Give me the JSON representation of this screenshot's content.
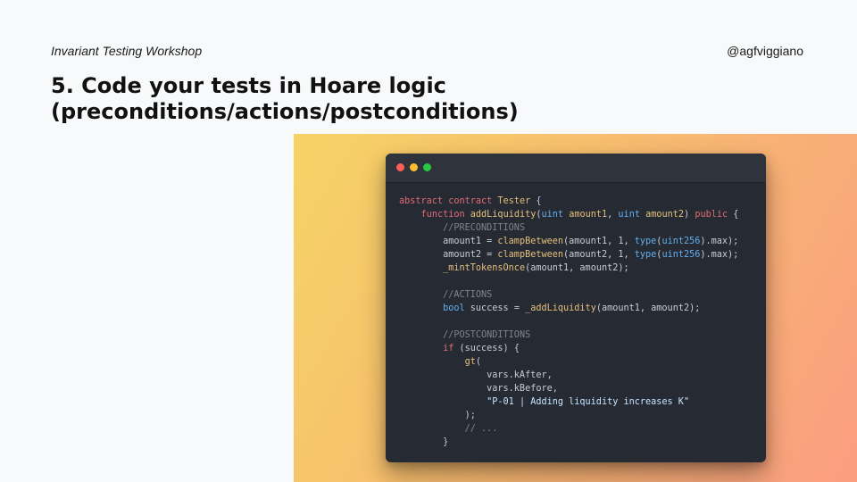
{
  "header": {
    "workshop": "Invariant Testing Workshop",
    "handle": "@agfviggiano",
    "title_line1": "5. Code your tests in Hoare logic",
    "title_line2": "(preconditions/actions/postconditions)"
  },
  "colors": {
    "gradient_start": "#f6d365",
    "gradient_end": "#fa9d80",
    "editor_bg": "#262a33",
    "window_dot_red": "#ff5f57",
    "window_dot_yellow": "#febc2e",
    "window_dot_green": "#28c840"
  },
  "code_lines": [
    [
      {
        "c": "kw",
        "t": "abstract contract"
      },
      {
        "c": "",
        "t": " "
      },
      {
        "c": "fn",
        "t": "Tester"
      },
      {
        "c": "",
        "t": " {"
      }
    ],
    [
      {
        "c": "",
        "t": "    "
      },
      {
        "c": "kw",
        "t": "function"
      },
      {
        "c": "",
        "t": " "
      },
      {
        "c": "fn",
        "t": "addLiquidity"
      },
      {
        "c": "",
        "t": "("
      },
      {
        "c": "ty",
        "t": "uint"
      },
      {
        "c": "",
        "t": " "
      },
      {
        "c": "fn",
        "t": "amount1"
      },
      {
        "c": "",
        "t": ", "
      },
      {
        "c": "ty",
        "t": "uint"
      },
      {
        "c": "",
        "t": " "
      },
      {
        "c": "fn",
        "t": "amount2"
      },
      {
        "c": "",
        "t": ") "
      },
      {
        "c": "kw",
        "t": "public"
      },
      {
        "c": "",
        "t": " {"
      }
    ],
    [
      {
        "c": "",
        "t": "        "
      },
      {
        "c": "cm",
        "t": "//PRECONDITIONS"
      }
    ],
    [
      {
        "c": "",
        "t": "        amount1 = "
      },
      {
        "c": "fn",
        "t": "clampBetween"
      },
      {
        "c": "",
        "t": "(amount1, 1, "
      },
      {
        "c": "ty",
        "t": "type"
      },
      {
        "c": "",
        "t": "("
      },
      {
        "c": "ty",
        "t": "uint256"
      },
      {
        "c": "",
        "t": ").max);"
      }
    ],
    [
      {
        "c": "",
        "t": "        amount2 = "
      },
      {
        "c": "fn",
        "t": "clampBetween"
      },
      {
        "c": "",
        "t": "(amount2, 1, "
      },
      {
        "c": "ty",
        "t": "type"
      },
      {
        "c": "",
        "t": "("
      },
      {
        "c": "ty",
        "t": "uint256"
      },
      {
        "c": "",
        "t": ").max);"
      }
    ],
    [
      {
        "c": "",
        "t": "        "
      },
      {
        "c": "fn",
        "t": "_mintTokensOnce"
      },
      {
        "c": "",
        "t": "(amount1, amount2);"
      }
    ],
    [
      {
        "c": "",
        "t": ""
      }
    ],
    [
      {
        "c": "",
        "t": "        "
      },
      {
        "c": "cm",
        "t": "//ACTIONS"
      }
    ],
    [
      {
        "c": "",
        "t": "        "
      },
      {
        "c": "ty",
        "t": "bool"
      },
      {
        "c": "",
        "t": " success = "
      },
      {
        "c": "fn",
        "t": "_addLiquidity"
      },
      {
        "c": "",
        "t": "(amount1, amount2);"
      }
    ],
    [
      {
        "c": "",
        "t": ""
      }
    ],
    [
      {
        "c": "",
        "t": "        "
      },
      {
        "c": "cm",
        "t": "//POSTCONDITIONS"
      }
    ],
    [
      {
        "c": "",
        "t": "        "
      },
      {
        "c": "kw",
        "t": "if"
      },
      {
        "c": "",
        "t": " (success) {"
      }
    ],
    [
      {
        "c": "",
        "t": "            "
      },
      {
        "c": "fn",
        "t": "gt"
      },
      {
        "c": "",
        "t": "("
      }
    ],
    [
      {
        "c": "",
        "t": "                vars.kAfter,"
      }
    ],
    [
      {
        "c": "",
        "t": "                vars.kBefore,"
      }
    ],
    [
      {
        "c": "",
        "t": "                "
      },
      {
        "c": "st",
        "t": "\"P-01 | Adding liquidity increases K\""
      }
    ],
    [
      {
        "c": "",
        "t": "            );"
      }
    ],
    [
      {
        "c": "",
        "t": "            "
      },
      {
        "c": "cm",
        "t": "// ..."
      }
    ],
    [
      {
        "c": "",
        "t": "        }"
      }
    ]
  ]
}
